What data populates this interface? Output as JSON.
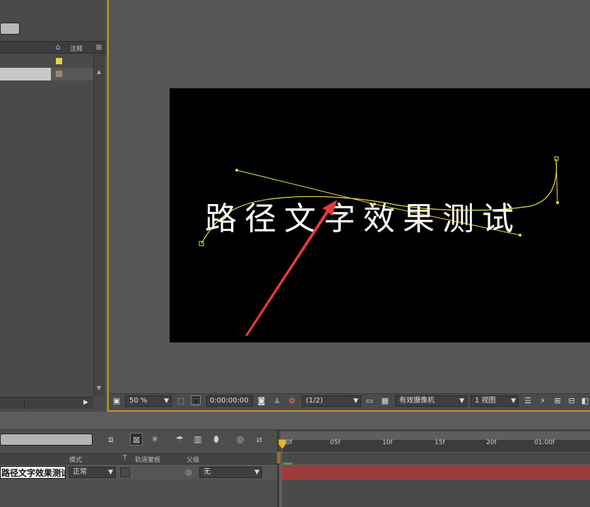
{
  "project_panel": {
    "header_label": "注释",
    "search_value": ""
  },
  "composition": {
    "text_on_path": "路径文字效果测试",
    "toolbar": {
      "zoom": "50 %",
      "timecode": "0:00:00:00",
      "resolution": "(1/2)",
      "camera": "有效摄像机",
      "views": "1 视图"
    }
  },
  "timeline": {
    "search_value": "",
    "columns": {
      "mode": "模式",
      "t": "T",
      "track_matte": "轨道蒙板",
      "parent": "父级"
    },
    "layer": {
      "name": "路径文字效果测试",
      "mode": "正常",
      "parent": "无"
    },
    "ruler_labels": [
      "00f",
      "05f",
      "10f",
      "15f",
      "20f",
      "01:00f"
    ]
  },
  "colors": {
    "accent_border": "#c39a26",
    "path": "#e8e23a",
    "arrow": "#e63a3a",
    "layer_bar": "#9b3c3c"
  }
}
